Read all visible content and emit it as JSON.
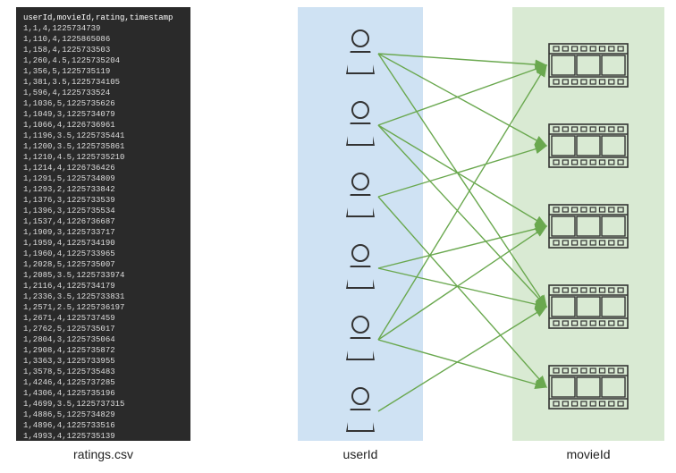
{
  "csv": {
    "header": "userId,movieId,rating,timestamp",
    "rows": [
      "1,1,4,1225734739",
      "1,110,4,1225865086",
      "1,158,4,1225733503",
      "1,260,4.5,1225735204",
      "1,356,5,1225735119",
      "1,381,3.5,1225734105",
      "1,596,4,1225733524",
      "1,1036,5,1225735626",
      "1,1049,3,1225734079",
      "1,1066,4,1226736961",
      "1,1196,3.5,1225735441",
      "1,1200,3.5,1225735861",
      "1,1210,4.5,1225735210",
      "1,1214,4,1226736426",
      "1,1291,5,1225734809",
      "1,1293,2,1225733842",
      "1,1376,3,1225733539",
      "1,1396,3,1225735534",
      "1,1537,4,1226736687",
      "1,1909,3,1225733717",
      "1,1959,4,1225734190",
      "1,1960,4,1225733965",
      "1,2028,5,1225735007",
      "1,2085,3.5,1225733974",
      "1,2116,4,1225734179",
      "1,2336,3.5,1225733831",
      "1,2571,2.5,1225736197",
      "1,2671,4,1225737459",
      "1,2762,5,1225735017",
      "1,2804,3,1225735064",
      "1,2908,4,1225735872",
      "1,3363,3,1225733955",
      "1,3578,5,1225735483",
      "1,4246,4,1225737285",
      "1,4306,4,1225735196",
      "1,4699,3.5,1225737315",
      "1,4886,5,1225734829",
      "1,4896,4,1225733516",
      "1,4993,4,1225735139"
    ]
  },
  "labels": {
    "file": "ratings.csv",
    "user_col": "userId",
    "movie_col": "movieId"
  },
  "diagram": {
    "users": 6,
    "movies": 5,
    "edges": [
      [
        0,
        0
      ],
      [
        0,
        1
      ],
      [
        0,
        3
      ],
      [
        1,
        0
      ],
      [
        1,
        2
      ],
      [
        1,
        3
      ],
      [
        2,
        1
      ],
      [
        2,
        4
      ],
      [
        3,
        2
      ],
      [
        3,
        3
      ],
      [
        4,
        0
      ],
      [
        4,
        2
      ],
      [
        4,
        4
      ],
      [
        5,
        3
      ]
    ]
  },
  "colors": {
    "user_panel": "#cfe2f3",
    "movie_panel": "#d9ead3",
    "arrow": "#6aa84f",
    "csv_bg": "#2a2a2a"
  }
}
